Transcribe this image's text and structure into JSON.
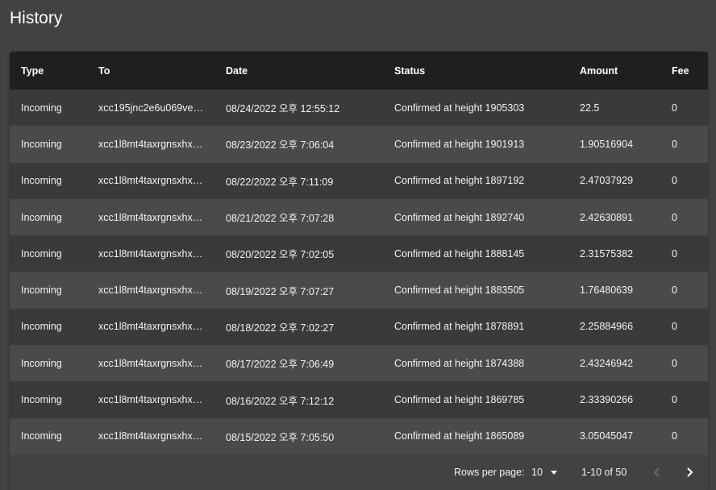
{
  "page": {
    "title": "History"
  },
  "table": {
    "columns": [
      "Type",
      "To",
      "Date",
      "Status",
      "Amount",
      "Fee"
    ],
    "rows": [
      {
        "type": "Incoming",
        "to": "xcc195jnc2e6u069ve9...",
        "date": "08/24/2022 오후 12:55:12",
        "status": "Confirmed at height 1905303",
        "amount": "22.5",
        "fee": "0"
      },
      {
        "type": "Incoming",
        "to": "xcc1l8mt4taxrgnsxhxk...",
        "date": "08/23/2022 오후 7:06:04",
        "status": "Confirmed at height 1901913",
        "amount": "1.90516904",
        "fee": "0"
      },
      {
        "type": "Incoming",
        "to": "xcc1l8mt4taxrgnsxhxk...",
        "date": "08/22/2022 오후 7:11:09",
        "status": "Confirmed at height 1897192",
        "amount": "2.47037929",
        "fee": "0"
      },
      {
        "type": "Incoming",
        "to": "xcc1l8mt4taxrgnsxhxk...",
        "date": "08/21/2022 오후 7:07:28",
        "status": "Confirmed at height 1892740",
        "amount": "2.42630891",
        "fee": "0"
      },
      {
        "type": "Incoming",
        "to": "xcc1l8mt4taxrgnsxhxk...",
        "date": "08/20/2022 오후 7:02:05",
        "status": "Confirmed at height 1888145",
        "amount": "2.31575382",
        "fee": "0"
      },
      {
        "type": "Incoming",
        "to": "xcc1l8mt4taxrgnsxhxk...",
        "date": "08/19/2022 오후 7:07:27",
        "status": "Confirmed at height 1883505",
        "amount": "1.76480639",
        "fee": "0"
      },
      {
        "type": "Incoming",
        "to": "xcc1l8mt4taxrgnsxhxk...",
        "date": "08/18/2022 오후 7:02:27",
        "status": "Confirmed at height 1878891",
        "amount": "2.25884966",
        "fee": "0"
      },
      {
        "type": "Incoming",
        "to": "xcc1l8mt4taxrgnsxhxk...",
        "date": "08/17/2022 오후 7:06:49",
        "status": "Confirmed at height 1874388",
        "amount": "2.43246942",
        "fee": "0"
      },
      {
        "type": "Incoming",
        "to": "xcc1l8mt4taxrgnsxhxk...",
        "date": "08/16/2022 오후 7:12:12",
        "status": "Confirmed at height 1869785",
        "amount": "2.33390266",
        "fee": "0"
      },
      {
        "type": "Incoming",
        "to": "xcc1l8mt4taxrgnsxhxk...",
        "date": "08/15/2022 오후 7:05:50",
        "status": "Confirmed at height 1865089",
        "amount": "3.05045047",
        "fee": "0"
      }
    ]
  },
  "pagination": {
    "rows_per_page_label": "Rows per page:",
    "rows_per_page_value": "10",
    "range_label": "1-10 of 50",
    "prev_icon": "chevron-left-icon",
    "next_icon": "chevron-right-icon"
  },
  "colors": {
    "background": "#424242",
    "header_background": "#1f1f1f",
    "row_odd": "#3a3a3a",
    "row_even": "#4a4a4a",
    "text": "#ffffff"
  }
}
